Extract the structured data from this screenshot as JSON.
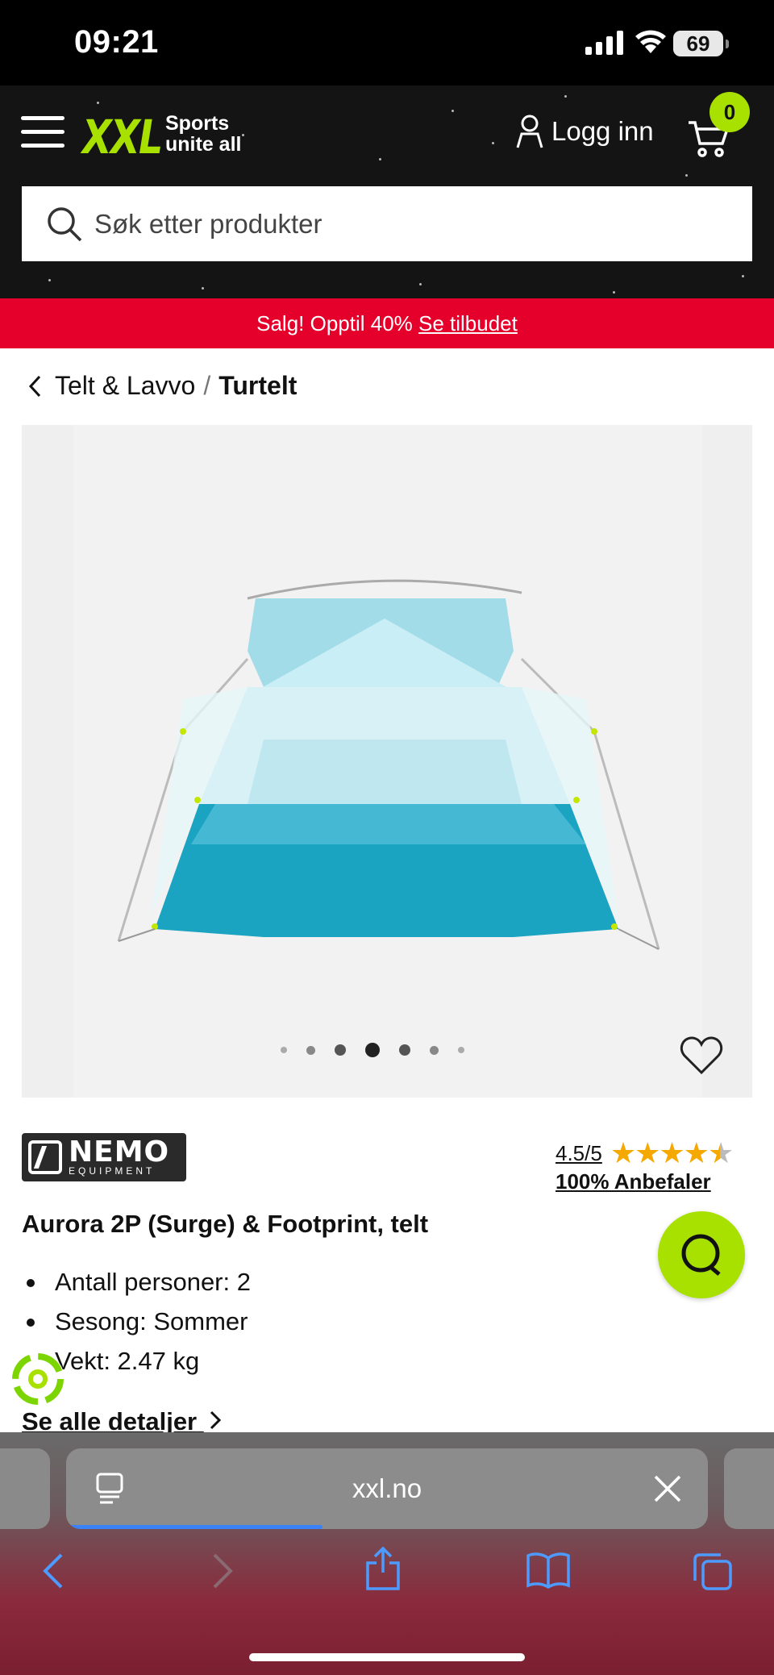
{
  "status_bar": {
    "time": "09:21",
    "battery": "69"
  },
  "header": {
    "logo": "XXL",
    "tagline_line1": "Sports",
    "tagline_line2": "unite all",
    "login_label": "Logg inn",
    "cart_count": "0",
    "search_placeholder": "Søk etter produkter"
  },
  "promo": {
    "text": "Salg! Opptil 40% ",
    "link": "Se tilbudet"
  },
  "breadcrumb": {
    "parent": "Telt & Lavvo",
    "separator": "/",
    "current": "Turtelt"
  },
  "gallery": {
    "image_count": 7,
    "active_index": 3
  },
  "product": {
    "brand_name": "NEMO",
    "brand_sub": "EQUIPMENT",
    "rating": "4.5/5",
    "rating_value": 4.5,
    "recommend": "100% Anbefaler",
    "title": "Aurora 2P (Surge) & Footprint, telt",
    "features": [
      "Antall personer: 2",
      "Sesong: Sommer",
      "Vekt: 2.47 kg"
    ],
    "details_link": "Se alle detaljer"
  },
  "browser": {
    "url": "xxl.no",
    "load_progress": 0.4
  },
  "colors": {
    "brand_green": "#a8e000",
    "promo_red": "#e4002b",
    "header_bg": "#141414",
    "star": "#f5a800"
  }
}
